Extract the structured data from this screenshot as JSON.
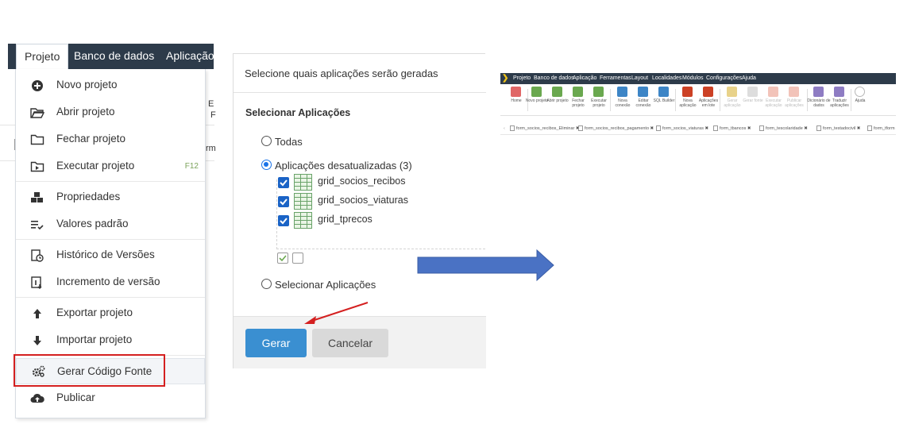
{
  "menubar": {
    "items": [
      "Projeto",
      "Banco de dados",
      "Aplicação"
    ]
  },
  "background_fragments": {
    "a": "E",
    "b": "F",
    "c": "rm"
  },
  "project_menu": {
    "items": [
      {
        "label": "Novo projeto",
        "icon": "plus-circle-icon"
      },
      {
        "label": "Abrir projeto",
        "icon": "folder-open-icon"
      },
      {
        "label": "Fechar projeto",
        "icon": "folder-icon"
      },
      {
        "label": "Executar projeto",
        "icon": "play-folder-icon",
        "shortcut": "F12"
      },
      {
        "label": "Propriedades",
        "icon": "cubes-icon"
      },
      {
        "label": "Valores padrão",
        "icon": "list-check-icon"
      },
      {
        "label": "Histórico de Versões",
        "icon": "version-history-icon"
      },
      {
        "label": "Incremento de versão",
        "icon": "version-increment-icon"
      },
      {
        "label": "Exportar projeto",
        "icon": "arrow-up-icon"
      },
      {
        "label": "Importar projeto",
        "icon": "arrow-down-icon"
      },
      {
        "label": "Gerar Código Fonte",
        "icon": "gears-icon"
      },
      {
        "label": "Publicar",
        "icon": "cloud-upload-icon"
      }
    ]
  },
  "dialog": {
    "title": "Selecione quais aplicações serão geradas",
    "subtitle": "Selecionar Aplicações",
    "option_all": "Todas",
    "option_outdated": "Aplicações desatualizadas (3)",
    "option_select": "Selecionar Aplicações",
    "selected_option": "Aplicações desatualizadas (3)",
    "apps": [
      "grid_socios_recibos",
      "grid_socios_viaturas",
      "grid_tprecos"
    ],
    "generate_button": "Gerar",
    "cancel_button": "Cancelar"
  },
  "mini_app": {
    "menu": [
      "Projeto",
      "Banco de dados",
      "Aplicação",
      "Ferramentas",
      "Layout",
      "Localidades",
      "Módulos",
      "Configurações",
      "Ajuda"
    ],
    "tools": [
      {
        "label": "Home",
        "icon": "home-icon",
        "color": "#e06666"
      },
      {
        "label": "Novo projeto",
        "icon": "new-project-icon",
        "color": "#6aa84f"
      },
      {
        "label": "Abrir projeto",
        "icon": "open-project-icon",
        "color": "#6aa84f"
      },
      {
        "label": "Fechar projeto",
        "icon": "close-project-icon",
        "color": "#6aa84f"
      },
      {
        "label": "Executar projeto",
        "icon": "run-project-icon",
        "color": "#6aa84f"
      },
      {
        "label": "Nova conexão",
        "icon": "new-connection-icon",
        "color": "#3d85c6"
      },
      {
        "label": "Editar conexão",
        "icon": "edit-connection-icon",
        "color": "#3d85c6"
      },
      {
        "label": "SQL Builder",
        "icon": "sql-builder-icon",
        "color": "#3d85c6"
      },
      {
        "label": "Nova aplicação",
        "icon": "new-app-icon",
        "color": "#cc4125"
      },
      {
        "label": "Aplicações em lote",
        "icon": "batch-apps-icon",
        "color": "#cc4125"
      },
      {
        "label": "Gerar aplicação",
        "icon": "generate-app-icon",
        "color": "#e8d28a"
      },
      {
        "label": "Gerar fonte",
        "icon": "generate-source-icon",
        "color": "#dddddd"
      },
      {
        "label": "Executar aplicação",
        "icon": "run-app-icon",
        "color": "#f2c3b9"
      },
      {
        "label": "Publicar aplicações",
        "icon": "publish-apps-icon",
        "color": "#f2c3b9"
      },
      {
        "label": "Dicionário de dados",
        "icon": "data-dictionary-icon",
        "color": "#8e7cc3"
      },
      {
        "label": "Traduzir aplicações",
        "icon": "translate-apps-icon",
        "color": "#8e7cc3"
      },
      {
        "label": "Ajuda",
        "icon": "help-icon",
        "color": "#b7b7b7"
      }
    ],
    "tabs": [
      "form_socios_recibos_Eliminar",
      "form_socios_recibos_pagamento",
      "form_socios_viaturas",
      "form_tbancos",
      "form_tescolaridade",
      "form_testadocivil",
      "form_tform"
    ]
  }
}
